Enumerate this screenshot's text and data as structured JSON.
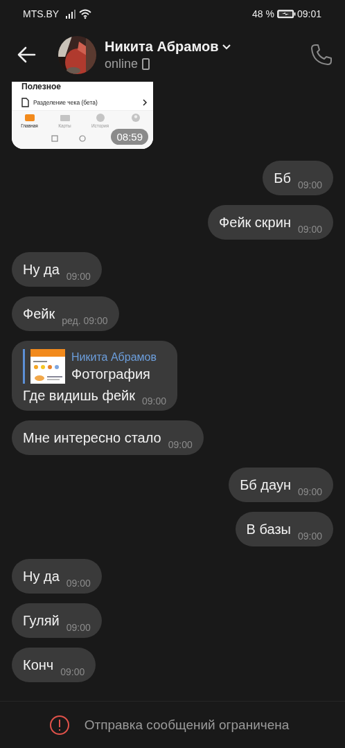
{
  "status_bar": {
    "carrier": "MTS.BY",
    "battery": "48 %",
    "time": "09:01"
  },
  "header": {
    "name": "Никита Абрамов",
    "status": "online"
  },
  "messages": [
    {
      "outgoing": false,
      "time": "08:59",
      "screenshot": {
        "section": "Полезное",
        "row": "Разделение чека (бета)",
        "tabs": [
          {
            "label": "Главная",
            "selected": true
          },
          {
            "label": "Карты",
            "selected": false
          },
          {
            "label": "История",
            "selected": false
          }
        ]
      }
    },
    {
      "kind": "text",
      "outgoing": true,
      "text": "Бб",
      "time": "09:00"
    },
    {
      "kind": "text",
      "outgoing": true,
      "text": "Фейк скрин",
      "time": "09:00"
    },
    {
      "kind": "text",
      "outgoing": false,
      "text": "Ну да",
      "time": "09:00"
    },
    {
      "kind": "text",
      "outgoing": false,
      "text": "Фейк",
      "time": "ред. 09:00"
    },
    {
      "kind": "reply",
      "outgoing": false,
      "quote": {
        "author": "Никита Абрамов",
        "text": "Фотография"
      },
      "text": "Где видишь фейк",
      "time": "09:00"
    },
    {
      "kind": "text",
      "outgoing": false,
      "text": "Мне интересно стало",
      "time": "09:00"
    },
    {
      "kind": "text",
      "outgoing": true,
      "text": "Бб даун",
      "time": "09:00"
    },
    {
      "kind": "text",
      "outgoing": true,
      "text": "В базы",
      "time": "09:00"
    },
    {
      "kind": "text",
      "outgoing": false,
      "text": "Ну да",
      "time": "09:00"
    },
    {
      "kind": "text",
      "outgoing": false,
      "text": "Гуляй",
      "time": "09:00"
    },
    {
      "kind": "text",
      "outgoing": false,
      "text": "Конч",
      "time": "09:00"
    }
  ],
  "footer": {
    "notice": "Отправка сообщений ограничена"
  }
}
